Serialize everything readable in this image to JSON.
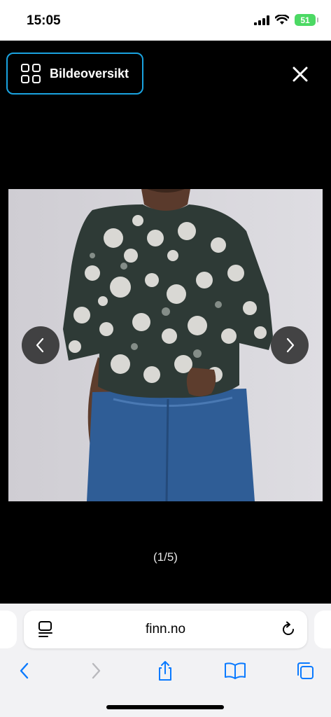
{
  "status_bar": {
    "time": "15:05",
    "battery": "51"
  },
  "viewer": {
    "overview_button_label": "Bildeoversikt",
    "counter": "(1/5)",
    "prev_icon": "chevron-left-icon",
    "next_icon": "chevron-right-icon",
    "close_icon": "close-icon"
  },
  "browser": {
    "url": "finn.no",
    "toolbar": [
      "back-icon",
      "forward-icon",
      "share-icon",
      "bookmarks-icon",
      "tabs-icon"
    ]
  },
  "colors": {
    "accent_border": "#1aa3e0",
    "battery": "#4cd964",
    "safari_blue": "#0a7aff"
  }
}
